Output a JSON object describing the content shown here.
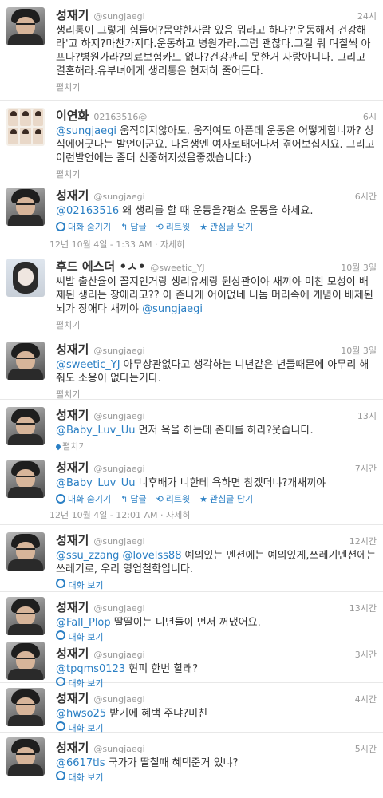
{
  "tweets": [
    {
      "name": "성재기",
      "handle": "@sungjaegi",
      "time": "24시",
      "avatar": "man",
      "text": "생리통이 그렇게 힘들어?몸약한사람 있음 뭐라고 하나?'운동해서 건강해라'고 하지?마찬가지다.운동하고 병원가라.그럼 괜찮다.그걸 뭐 며칠씩 아프다?병원가라?의료보험카드 없나?건강관리 못한거 자랑아니다. 그리고 결혼해라.유부녀에게 생리통은 현저히 줄어든다.",
      "expand": "펼치기"
    },
    {
      "name": "이연화",
      "handle": "02163516@",
      "time": "6시",
      "avatar": "grid",
      "mention": "@sungjaegi",
      "text": " 움직이지않아도. 움직여도 아픈데 운동은 어떻게합니까? 상식에어긋나는 발언이군요. 다음생엔 여자로태어나서 겪어보십시요. 그리고 이런발언에는 좀더 신중해지셨음좋겠습니다:)",
      "expand": "펼치기"
    },
    {
      "name": "성재기",
      "handle": "@sungjaegi",
      "time": "6시간",
      "avatar": "man",
      "mention": "@02163516",
      "text": " 왜 생리를 할 때 운동을?평소 운동을 하세요.",
      "actions": [
        "대화 숨기기",
        "답글",
        "리트윗",
        "관심글 담기"
      ],
      "detail": "12년 10월 4일 - 1:33 AM · 자세히"
    },
    {
      "name": "후드 에스더 •ㅅ•",
      "handle": "@sweetic_YJ",
      "time": "10월 3일",
      "avatar": "girl",
      "text": "씨발 출산율이 꼴지인거랑 생리유세랑 뭔상관이야 새끼야 미친 모성이 배제된 생리는 장애라고?? 아 존나게 어이없네 니놈 머리속에 개념이 배제된 뇌가 장애다 새끼야 ",
      "mention_end": "@sungjaegi",
      "expand": "펼치기"
    },
    {
      "name": "성재기",
      "handle": "@sungjaegi",
      "time": "10월 3일",
      "avatar": "man",
      "mention": "@sweetic_YJ",
      "text": " 아무상관없다고 생각하는 니년같은 년들때문에 아무리 해줘도 소용이 없다는거다.",
      "expand": "펼치기"
    },
    {
      "name": "성재기",
      "handle": "@sungjaegi",
      "time": "13시",
      "avatar": "man",
      "mention": "@Baby_Luv_Uu",
      "text": " 먼저 욕을 하는데 존대를 하라?웃습니다.",
      "expand": "펼치기"
    },
    {
      "name": "성재기",
      "handle": "@sungjaegi",
      "time": "7시간",
      "avatar": "man",
      "mention": "@Baby_Luv_Uu",
      "text": " 니후배가 니한테 욕하면 참겠더냐?개새끼야",
      "actions": [
        "대화 숨기기",
        "답글",
        "리트윗",
        "관심글 담기"
      ],
      "detail": "12년 10월 4일 - 12:01 AM · 자세히"
    },
    {
      "name": "성재기",
      "handle": "@sungjaegi",
      "time": "12시간",
      "avatar": "man",
      "mention": "@ssu_zzang @lovelss88",
      "text": " 예의있는 멘션에는 예의있게,쓰레기멘션에는 쓰레기로, 우리 영업철학입니다.",
      "conv": "대화 보기"
    },
    {
      "name": "성재기",
      "handle": "@sungjaegi",
      "time": "13시간",
      "avatar": "man",
      "mention": "@Fall_Plop",
      "text": " 딸딸이는 니년들이 먼저 꺼냈어요.",
      "conv": "대화 보기"
    },
    {
      "name": "성재기",
      "handle": "@sungjaegi",
      "time": "3시간",
      "avatar": "man",
      "mention": "@tpqms0123",
      "text": " 현피 한번 할래?",
      "conv": "대화 보기"
    },
    {
      "name": "성재기",
      "handle": "@sungjaegi",
      "time": "4시간",
      "avatar": "man",
      "mention": "@hwso25",
      "text": " 받기에 혜택 주냐?미친",
      "conv": "대화 보기"
    },
    {
      "name": "성재기",
      "handle": "@sungjaegi",
      "time": "5시간",
      "avatar": "man",
      "mention": "@6617tls",
      "text": " 국가가 딸칠때 혜택준거 있냐?",
      "conv": "대화 보기"
    }
  ]
}
